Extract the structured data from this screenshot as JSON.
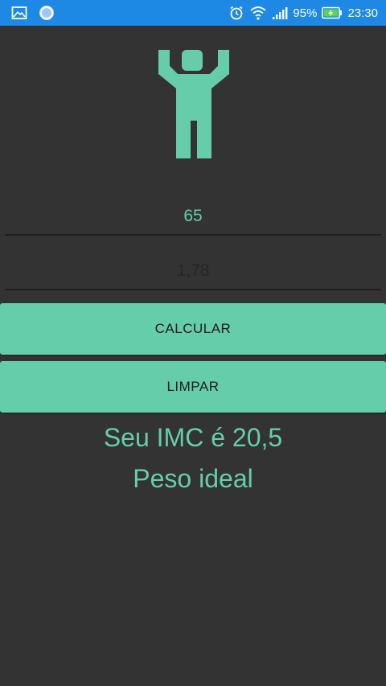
{
  "status_bar": {
    "battery_percent": "95%",
    "time": "23:30",
    "icons": [
      "gallery-icon",
      "sync-circle-icon",
      "alarm-icon",
      "wifi-icon",
      "signal-icon",
      "battery-charging-icon"
    ]
  },
  "form": {
    "weight_value": "65",
    "height_placeholder": "1,78"
  },
  "buttons": {
    "calculate_label": "CALCULAR",
    "clear_label": "LIMPAR"
  },
  "result": {
    "imc_text": "Seu IMC é 20,5",
    "status_text": "Peso ideal"
  },
  "colors": {
    "accent": "#66cdaa",
    "background": "#333333",
    "status_bar": "#1e88e5"
  }
}
